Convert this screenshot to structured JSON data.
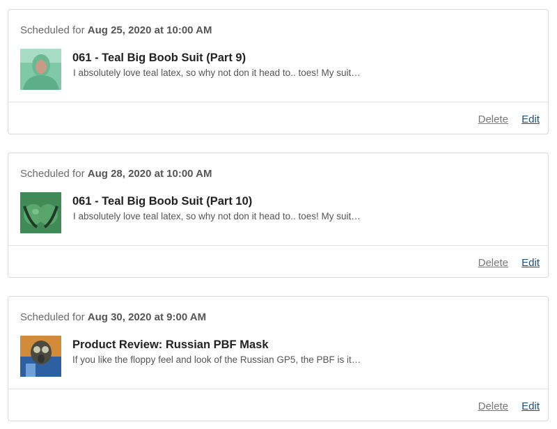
{
  "posts": [
    {
      "scheduled_prefix": "Scheduled for",
      "scheduled_date": "Aug 25, 2020 at 10:00 AM",
      "title": "061 - Teal Big Boob Suit (Part 9)",
      "excerpt": "I absolutely love teal latex, so why not don it head to.. toes! My suit…",
      "delete_label": "Delete",
      "edit_label": "Edit"
    },
    {
      "scheduled_prefix": "Scheduled for",
      "scheduled_date": "Aug 28, 2020 at 10:00 AM",
      "title": "061 - Teal Big Boob Suit (Part 10)",
      "excerpt": "I absolutely love teal latex, so why not don it head to.. toes! My suit…",
      "delete_label": "Delete",
      "edit_label": "Edit"
    },
    {
      "scheduled_prefix": "Scheduled for",
      "scheduled_date": "Aug 30, 2020 at 9:00 AM",
      "title": "Product Review: Russian PBF Mask",
      "excerpt": "If you like the floppy feel and look of the Russian GP5, the PBF is it…",
      "delete_label": "Delete",
      "edit_label": "Edit"
    }
  ],
  "colors": {
    "border": "#d9d9d9",
    "edit_link": "#1d4f73",
    "delete_link": "#777777",
    "title": "#222222"
  }
}
